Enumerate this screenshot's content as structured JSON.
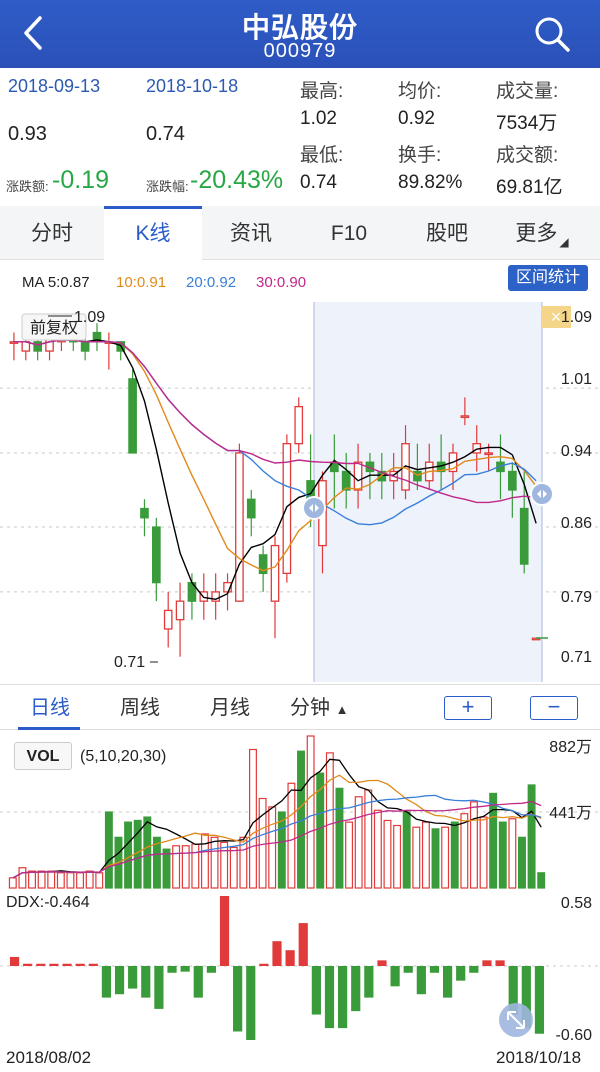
{
  "header": {
    "title": "中弘股份",
    "code": "000979"
  },
  "info": {
    "date_start": "2018-09-13",
    "date_end": "2018-10-18",
    "price_start": "0.93",
    "price_end": "0.74",
    "change_amount_label": "涨跌额:",
    "change_amount": "-0.19",
    "change_pct_label": "涨跌幅:",
    "change_pct": "-20.43%",
    "high_label": "最高:",
    "high": "1.02",
    "low_label": "最低:",
    "low": "0.74",
    "avg_label": "均价:",
    "avg": "0.92",
    "turnover_label": "换手:",
    "turnover": "89.82%",
    "volume_label": "成交量:",
    "volume": "7534万",
    "amount_label": "成交额:",
    "amount": "69.81亿"
  },
  "tabs": [
    "分时",
    "K线",
    "资讯",
    "F10",
    "股吧",
    "更多"
  ],
  "ma": {
    "label": "MA 5:0.87",
    "ma10": "10:0.91",
    "ma20": "20:0.92",
    "ma30": "30:0.90",
    "stats_button": "区间统计"
  },
  "kline": {
    "adjust_label": "前复权",
    "left_high_label": "1.09",
    "left_low_label": "0.71",
    "right_axis": [
      "1.09",
      "1.01",
      "0.94",
      "0.86",
      "0.79",
      "0.71"
    ],
    "close_icon": "×"
  },
  "periods": {
    "items": [
      "日线",
      "周线",
      "月线",
      "分钟"
    ],
    "minute_arrow": "▲",
    "plus": "+",
    "minus": "−"
  },
  "volume": {
    "tag": "VOL",
    "params": "(5,10,20,30)",
    "max_label": "882万",
    "mid_label": "441万"
  },
  "ddx": {
    "label": "DDX:-0.464",
    "max_label": "0.58",
    "min_label": "-0.60"
  },
  "dates": {
    "start": "2018/08/02",
    "end": "2018/10/18"
  },
  "colors": {
    "header": "#2a51b8",
    "up": "#e03a3a",
    "down": "#3a9b3a",
    "ma5": "#000000",
    "ma10": "#e08a1a",
    "ma20": "#3a7fd9",
    "ma30": "#c0288a",
    "accent": "#2a5bc9"
  },
  "chart_data": {
    "type": "candlestick",
    "candles": [
      {
        "o": 1.06,
        "c": 1.06,
        "h": 1.07,
        "l": 1.04
      },
      {
        "o": 1.05,
        "c": 1.06,
        "h": 1.07,
        "l": 1.04
      },
      {
        "o": 1.06,
        "c": 1.05,
        "h": 1.07,
        "l": 1.04
      },
      {
        "o": 1.05,
        "c": 1.07,
        "h": 1.08,
        "l": 1.04
      },
      {
        "o": 1.06,
        "c": 1.07,
        "h": 1.09,
        "l": 1.05
      },
      {
        "o": 1.07,
        "c": 1.06,
        "h": 1.08,
        "l": 1.05
      },
      {
        "o": 1.06,
        "c": 1.05,
        "h": 1.07,
        "l": 1.04
      },
      {
        "o": 1.07,
        "c": 1.06,
        "h": 1.08,
        "l": 1.05
      },
      {
        "o": 1.06,
        "c": 1.06,
        "h": 1.07,
        "l": 1.03
      },
      {
        "o": 1.06,
        "c": 1.05,
        "h": 1.06,
        "l": 1.04
      },
      {
        "o": 1.02,
        "c": 0.94,
        "h": 1.03,
        "l": 0.94
      },
      {
        "o": 0.88,
        "c": 0.87,
        "h": 0.89,
        "l": 0.85
      },
      {
        "o": 0.86,
        "c": 0.8,
        "h": 0.87,
        "l": 0.78
      },
      {
        "o": 0.75,
        "c": 0.77,
        "h": 0.79,
        "l": 0.73
      },
      {
        "o": 0.76,
        "c": 0.78,
        "h": 0.8,
        "l": 0.72
      },
      {
        "o": 0.8,
        "c": 0.78,
        "h": 0.81,
        "l": 0.76
      },
      {
        "o": 0.78,
        "c": 0.79,
        "h": 0.81,
        "l": 0.76
      },
      {
        "o": 0.78,
        "c": 0.79,
        "h": 0.81,
        "l": 0.76
      },
      {
        "o": 0.79,
        "c": 0.8,
        "h": 0.81,
        "l": 0.77
      },
      {
        "o": 0.78,
        "c": 0.94,
        "h": 0.95,
        "l": 0.78
      },
      {
        "o": 0.89,
        "c": 0.87,
        "h": 0.9,
        "l": 0.85
      },
      {
        "o": 0.83,
        "c": 0.81,
        "h": 0.84,
        "l": 0.79
      },
      {
        "o": 0.78,
        "c": 0.84,
        "h": 0.85,
        "l": 0.74
      },
      {
        "o": 0.81,
        "c": 0.95,
        "h": 0.96,
        "l": 0.8
      },
      {
        "o": 0.95,
        "c": 0.99,
        "h": 1.0,
        "l": 0.94
      },
      {
        "o": 0.91,
        "c": 0.89,
        "h": 0.96,
        "l": 0.86
      },
      {
        "o": 0.84,
        "c": 0.91,
        "h": 0.92,
        "l": 0.81
      },
      {
        "o": 0.93,
        "c": 0.92,
        "h": 0.96,
        "l": 0.88
      },
      {
        "o": 0.92,
        "c": 0.9,
        "h": 0.94,
        "l": 0.88
      },
      {
        "o": 0.9,
        "c": 0.93,
        "h": 0.95,
        "l": 0.88
      },
      {
        "o": 0.93,
        "c": 0.92,
        "h": 0.94,
        "l": 0.89
      },
      {
        "o": 0.92,
        "c": 0.91,
        "h": 0.94,
        "l": 0.89
      },
      {
        "o": 0.91,
        "c": 0.92,
        "h": 0.94,
        "l": 0.89
      },
      {
        "o": 0.9,
        "c": 0.95,
        "h": 0.97,
        "l": 0.89
      },
      {
        "o": 0.92,
        "c": 0.91,
        "h": 0.95,
        "l": 0.9
      },
      {
        "o": 0.91,
        "c": 0.93,
        "h": 0.95,
        "l": 0.9
      },
      {
        "o": 0.93,
        "c": 0.92,
        "h": 0.96,
        "l": 0.9
      },
      {
        "o": 0.92,
        "c": 0.94,
        "h": 0.95,
        "l": 0.9
      },
      {
        "o": 0.98,
        "c": 0.98,
        "h": 1.0,
        "l": 0.97
      },
      {
        "o": 0.94,
        "c": 0.95,
        "h": 0.97,
        "l": 0.92
      },
      {
        "o": 0.94,
        "c": 0.94,
        "h": 0.95,
        "l": 0.92
      },
      {
        "o": 0.93,
        "c": 0.92,
        "h": 0.96,
        "l": 0.89
      },
      {
        "o": 0.92,
        "c": 0.9,
        "h": 0.93,
        "l": 0.87
      },
      {
        "o": 0.88,
        "c": 0.82,
        "h": 0.92,
        "l": 0.81
      },
      {
        "o": 0.74,
        "c": 0.74,
        "h": 0.74,
        "l": 0.74
      }
    ],
    "volumes": [
      0.6,
      1.2,
      1.0,
      1.0,
      1.0,
      0.9,
      0.9,
      0.9,
      1.0,
      0.9,
      4.5,
      3.0,
      3.9,
      4.0,
      4.2,
      3.0,
      2.3,
      2.5,
      2.5,
      2.6,
      3.2,
      3.0,
      2.7,
      2.4,
      3.0,
      8.2,
      5.3,
      4.8,
      4.5,
      6.2,
      8.1,
      9.0,
      6.8,
      8.0,
      5.9,
      3.9,
      5.4,
      5.8,
      4.6,
      4.0,
      3.7,
      4.5,
      3.6,
      3.9,
      3.5,
      3.6,
      3.9,
      4.4,
      5.1,
      4.2,
      5.6,
      3.9,
      4.1,
      3.0,
      6.1,
      0.9
    ],
    "vol_max_label": "882万",
    "ddx_values": [
      0.08,
      0.02,
      0.02,
      0.02,
      0.02,
      0.02,
      0.02,
      -0.28,
      -0.25,
      -0.2,
      -0.28,
      -0.38,
      -0.06,
      -0.05,
      -0.28,
      -0.06,
      0.62,
      -0.58,
      -0.75,
      0.02,
      0.22,
      0.14,
      0.38,
      -0.43,
      -0.55,
      -0.55,
      -0.4,
      -0.28,
      0.05,
      -0.18,
      -0.06,
      -0.25,
      -0.06,
      -0.28,
      -0.13,
      -0.06,
      0.05,
      0.05,
      -0.43,
      -0.55,
      -0.6
    ],
    "right_axis": [
      1.09,
      1.01,
      0.94,
      0.86,
      0.79,
      0.71
    ]
  }
}
